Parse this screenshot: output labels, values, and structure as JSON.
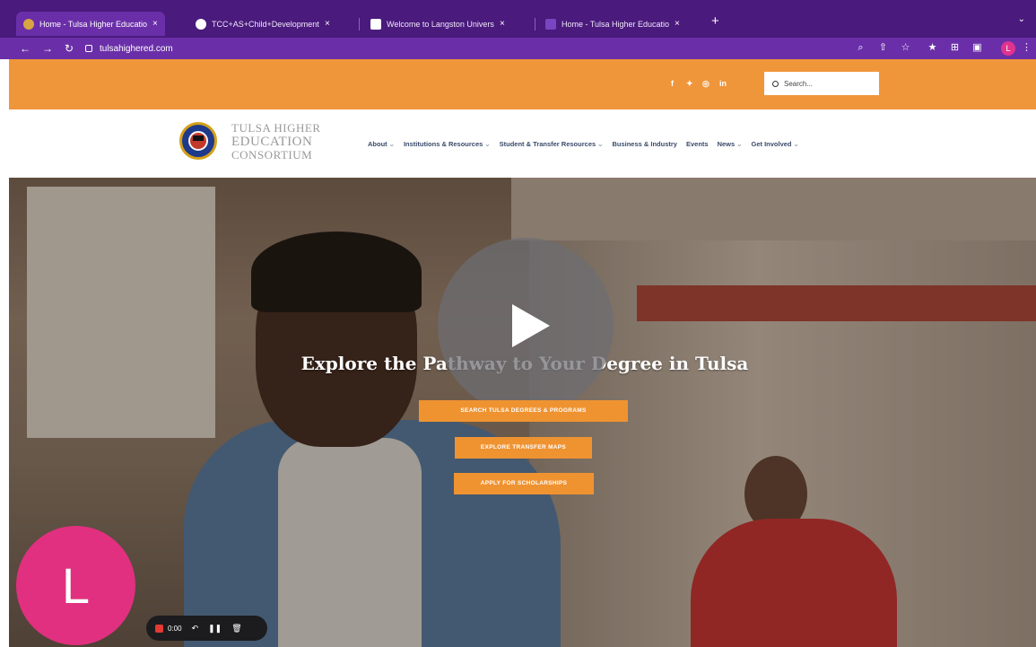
{
  "browser": {
    "tabs": [
      {
        "label": "Home - Tulsa Higher Educatio",
        "active": true,
        "favicon_color": "#d9a441"
      },
      {
        "label": "TCC+AS+Child+Development",
        "active": false,
        "favicon_color": "#ffffff"
      },
      {
        "label": "Welcome to Langston Universi",
        "active": false,
        "favicon_color": "#ffffff"
      },
      {
        "label": "Home - Tulsa Higher Educatio",
        "active": false,
        "favicon_color": "#6a2fa8"
      }
    ],
    "url": "tulsahighered.com",
    "profile_initial": "L"
  },
  "topbar": {
    "social": [
      "f",
      "t",
      "ig",
      "in"
    ],
    "search_placeholder": "Search..."
  },
  "header": {
    "logo_lines": [
      "TULSA HIGHER",
      "EDUCATION",
      "CONSORTIUM"
    ],
    "nav": [
      {
        "label": "About",
        "caret": "⌄"
      },
      {
        "label": "Institutions & Resources",
        "caret": "⌄"
      },
      {
        "label": "Student & Transfer Resources",
        "caret": "⌄"
      },
      {
        "label": "Business & Industry",
        "caret": ""
      },
      {
        "label": "Events",
        "caret": ""
      },
      {
        "label": "News",
        "caret": "⌄"
      },
      {
        "label": "Get Involved",
        "caret": "⌄"
      }
    ]
  },
  "hero": {
    "headline": "Explore the Pathway to Your Degree in Tulsa",
    "buttons": [
      "Search Tulsa Degrees & Programs",
      "Explore Transfer Maps",
      "Apply for Scholarships"
    ]
  },
  "recorder": {
    "avatar_initial": "L",
    "time": "0:00"
  },
  "colors": {
    "chrome_dark": "#4a1a7c",
    "chrome": "#6a2fa8",
    "brand_orange": "#f0963a",
    "nav_text": "#3a4a6a",
    "recorder_avatar": "#e0307f"
  }
}
